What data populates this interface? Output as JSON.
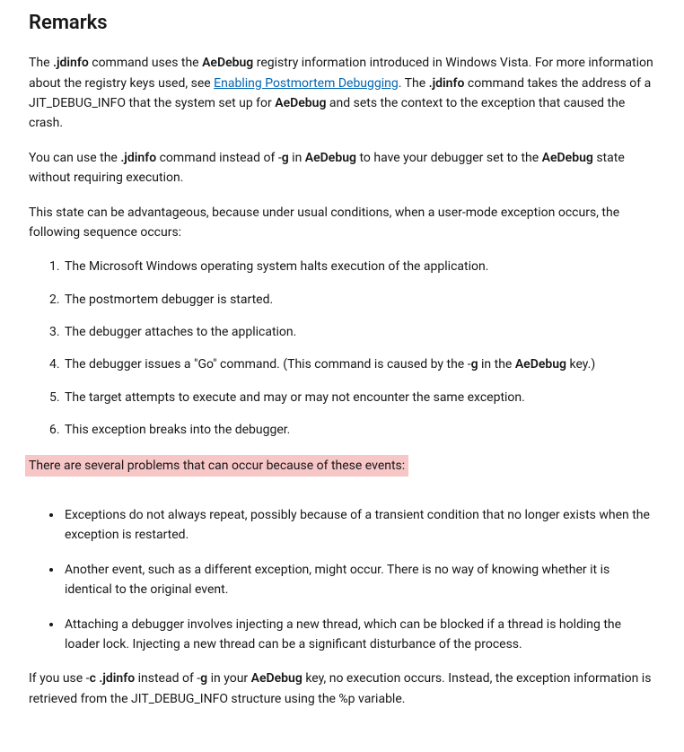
{
  "heading": "Remarks",
  "p1_part1": "The ",
  "p1_jdinfo": ".jdinfo",
  "p1_part2": " command uses the ",
  "p1_aedebug": "AeDebug",
  "p1_part3": " registry information introduced in Windows Vista. For more information about the registry keys used, see ",
  "p1_link": "Enabling Postmortem Debugging",
  "p1_part4": ". The ",
  "p1_jdinfo2": ".jdinfo",
  "p1_part5": " command takes the address of a JIT_DEBUG_INFO that the system set up for ",
  "p1_aedebug2": "AeDebug",
  "p1_part6": " and sets the context to the exception that caused the crash.",
  "p2_part1": "You can use the ",
  "p2_jdinfo": ".jdinfo",
  "p2_part2": " command instead of -",
  "p2_g": "g",
  "p2_part3": " in ",
  "p2_aedebug": "AeDebug",
  "p2_part4": " to have your debugger set to the ",
  "p2_aedebug2": "AeDebug",
  "p2_part5": " state without requiring execution.",
  "p3": "This state can be advantageous, because under usual conditions, when a user-mode exception occurs, the following sequence occurs:",
  "ol_items": {
    "item1": "The Microsoft Windows operating system halts execution of the application.",
    "item2": "The postmortem debugger is started.",
    "item3": "The debugger attaches to the application.",
    "item4_part1": "The debugger issues a \"Go\" command. (This command is caused by the -",
    "item4_g": "g",
    "item4_part2": " in the ",
    "item4_aedebug": "AeDebug",
    "item4_part3": " key.)",
    "item5": "The target attempts to execute and may or may not encounter the same exception.",
    "item6": "This exception breaks into the debugger."
  },
  "p4_highlight": "There are several problems that can occur because of these events:",
  "ul_items": {
    "item1": "Exceptions do not always repeat, possibly because of a transient condition that no longer exists when the exception is restarted.",
    "item2": "Another event, such as a different exception, might occur. There is no way of knowing whether it is identical to the original event.",
    "item3": "Attaching a debugger involves injecting a new thread, which can be blocked if a thread is holding the loader lock. Injecting a new thread can be a significant disturbance of the process."
  },
  "p5_part1": "If you use -",
  "p5_c": "c .jdinfo",
  "p5_part2": " instead of -",
  "p5_g": "g",
  "p5_part3": " in your ",
  "p5_aedebug": "AeDebug",
  "p5_part4": " key, no execution occurs. Instead, the exception information is retrieved from the JIT_DEBUG_INFO structure using the %p variable."
}
